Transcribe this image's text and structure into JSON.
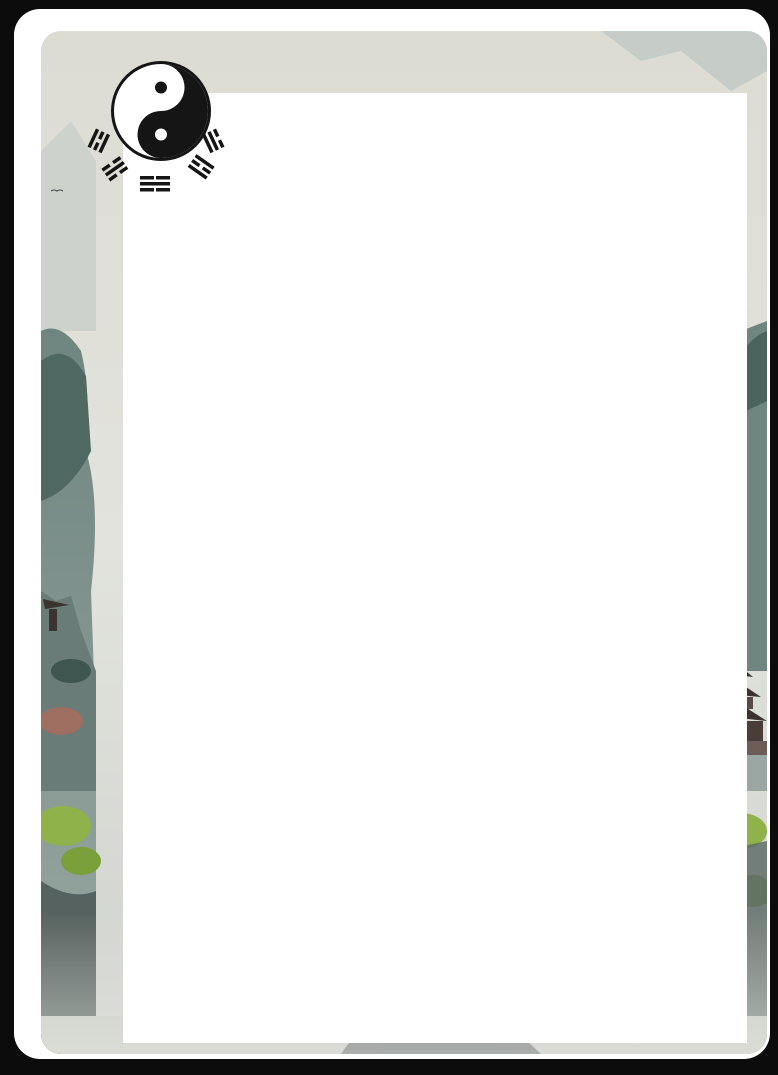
{
  "card": {
    "frame_color": "#0c0c0c",
    "border_color": "#ffffff",
    "panel_color": "#ffffff",
    "background_palette": {
      "mist": "#dcddd6",
      "mountain": "#7f918c",
      "mountain_dark": "#5b6d68",
      "foliage": "#8fb24a",
      "pagoda": "#3a3330",
      "water": "#c9ccc5"
    }
  },
  "emblem": {
    "icon": "yin-yang-bagua-icon",
    "colors": {
      "dark": "#151515",
      "light": "#ffffff"
    }
  }
}
